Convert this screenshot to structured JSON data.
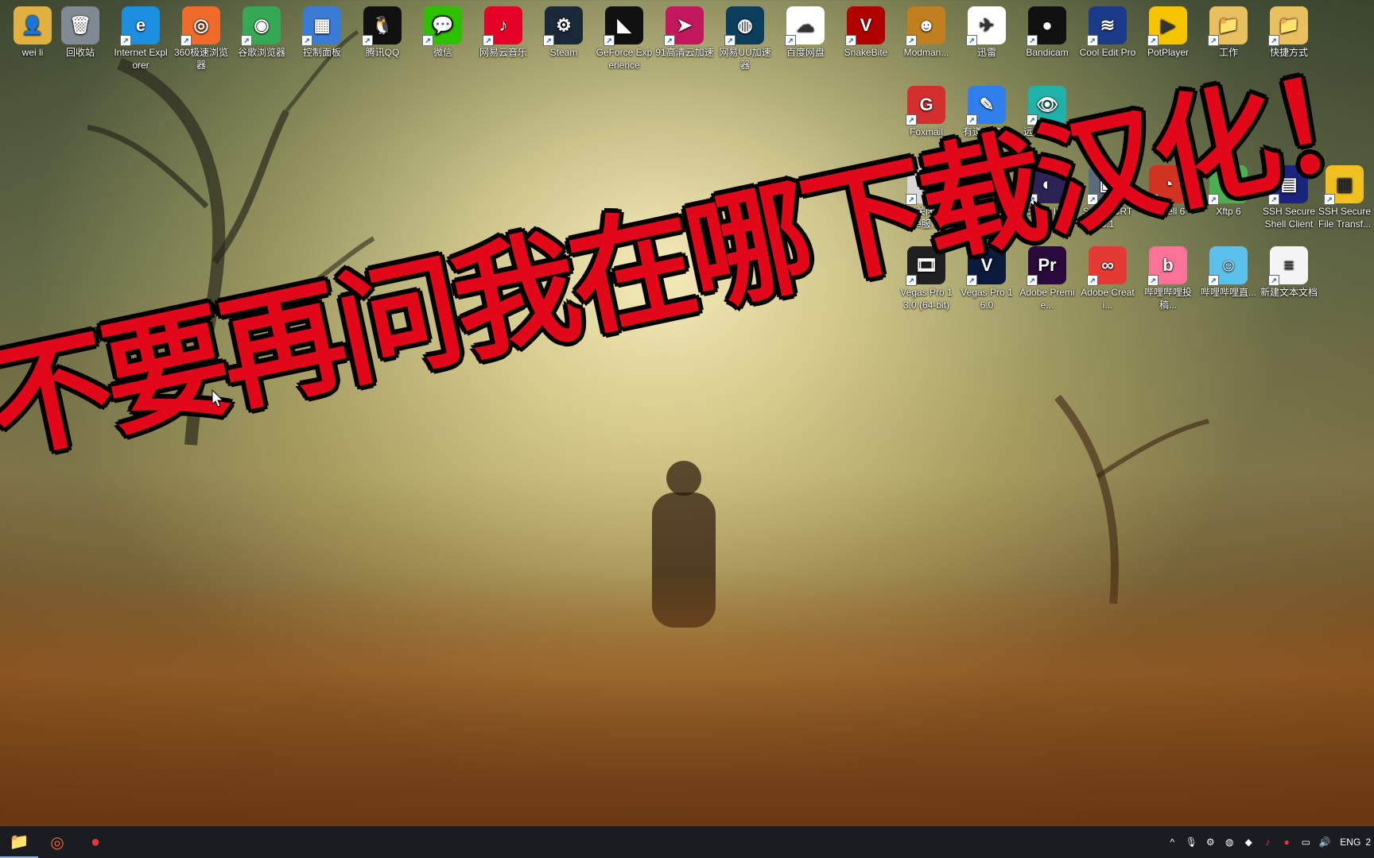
{
  "desktop": {
    "icons": [
      {
        "label": "wei li",
        "icon": "user-folder-icon",
        "color": "#e0b040",
        "glyph": "👤"
      },
      {
        "label": "回收站",
        "icon": "recycle-bin-icon",
        "color": "#7f8a93",
        "glyph": "🗑"
      },
      {
        "label": "Internet Explorer",
        "icon": "ie-icon",
        "color": "#1d8fe1",
        "glyph": "e"
      },
      {
        "label": "360极速浏览器",
        "icon": "360-browser-icon",
        "color": "#f06a2a",
        "glyph": "◎"
      },
      {
        "label": "谷歌浏览器",
        "icon": "chrome-icon",
        "color": "#34a853",
        "glyph": "◉"
      },
      {
        "label": "控制面板",
        "icon": "control-panel-icon",
        "color": "#3a7bd5",
        "glyph": "▦"
      },
      {
        "label": "腾讯QQ",
        "icon": "qq-icon",
        "color": "#111111",
        "glyph": "🐧"
      },
      {
        "label": "微信",
        "icon": "wechat-icon",
        "color": "#2dc100",
        "glyph": "💬"
      },
      {
        "label": "网易云音乐",
        "icon": "netease-music-icon",
        "color": "#e60026",
        "glyph": "♪"
      },
      {
        "label": "Steam",
        "icon": "steam-icon",
        "color": "#1b2838",
        "glyph": "⚙"
      },
      {
        "label": "GeForce Experience",
        "icon": "geforce-icon",
        "color": "#111111",
        "glyph": "◣"
      },
      {
        "label": "91高清云加速",
        "icon": "91-accelerator-icon",
        "color": "#c2185b",
        "glyph": "➤"
      },
      {
        "label": "网易UU加速器",
        "icon": "uu-accelerator-icon",
        "color": "#0b3d5c",
        "glyph": "◍"
      },
      {
        "label": "百度网盘",
        "icon": "baidu-netdisk-icon",
        "color": "#ffffff",
        "glyph": "☁"
      },
      {
        "label": "SnakeBite",
        "icon": "snakebite-icon",
        "color": "#b00000",
        "glyph": "V"
      },
      {
        "label": "Modman...",
        "icon": "modman-icon",
        "color": "#c08020",
        "glyph": "☻"
      },
      {
        "label": "迅雷",
        "icon": "thunder-icon",
        "color": "#ffffff",
        "glyph": "✈"
      },
      {
        "label": "Bandicam",
        "icon": "bandicam-icon",
        "color": "#111111",
        "glyph": "●"
      },
      {
        "label": "Cool Edit Pro",
        "icon": "cool-edit-icon",
        "color": "#1a3a8a",
        "glyph": "≋"
      },
      {
        "label": "PotPlayer",
        "icon": "potplayer-icon",
        "color": "#f5c400",
        "glyph": "▶"
      },
      {
        "label": "工作",
        "icon": "folder-icon",
        "color": "#e8c060",
        "glyph": "📁"
      },
      {
        "label": "快捷方式",
        "icon": "folder-icon",
        "color": "#e8c060",
        "glyph": "📁"
      },
      {
        "label": "Foxmail",
        "icon": "foxmail-icon",
        "color": "#d32f2f",
        "glyph": "G"
      },
      {
        "label": "有道云笔记",
        "icon": "youdao-note-icon",
        "color": "#2f80ed",
        "glyph": "✎"
      },
      {
        "label": "远程客户端",
        "icon": "remote-client-icon",
        "color": "#20b2aa",
        "glyph": "👁"
      },
      {
        "label": "开启关闭Oracle服...",
        "icon": "oracle-service-icon",
        "color": "#d8d8d8",
        "glyph": "⚙"
      },
      {
        "label": "PLSQL Developer",
        "icon": "plsql-icon",
        "color": "#9a2f6a",
        "glyph": "⛁"
      },
      {
        "label": "Eclipse IDE for Enter...",
        "icon": "eclipse-icon",
        "color": "#2c2255",
        "glyph": "◐"
      },
      {
        "label": "SecureCRT 8.1",
        "icon": "securecrt-icon",
        "color": "#5a6b7c",
        "glyph": "▣"
      },
      {
        "label": "Xshell 6",
        "icon": "xshell-icon",
        "color": "#d0331f",
        "glyph": "◔"
      },
      {
        "label": "Xftp 6",
        "icon": "xftp-icon",
        "color": "#4caf50",
        "glyph": "⇅"
      },
      {
        "label": "SSH Secure Shell Client",
        "icon": "ssh-client-icon",
        "color": "#1a237e",
        "glyph": "▤"
      },
      {
        "label": "SSH Secure File Transf...",
        "icon": "ssh-file-transfer-icon",
        "color": "#f0c020",
        "glyph": "▥"
      },
      {
        "label": "Vegas Pro 13.0 (64-bit)",
        "icon": "vegas-icon",
        "color": "#202020",
        "glyph": "🎞"
      },
      {
        "label": "Vegas Pro 16.0",
        "icon": "vegas-icon",
        "color": "#0a1a3a",
        "glyph": "V"
      },
      {
        "label": "Adobe Premie...",
        "icon": "premiere-icon",
        "color": "#2a0a3a",
        "glyph": "Pr"
      },
      {
        "label": "Adobe Creati...",
        "icon": "creative-cloud-icon",
        "color": "#e53935",
        "glyph": "∞"
      },
      {
        "label": "哔哩哔哩投稿...",
        "icon": "bilibili-upload-icon",
        "color": "#fb7299",
        "glyph": "b"
      },
      {
        "label": "哔哩哔哩直...",
        "icon": "bilibili-live-icon",
        "color": "#5bc0eb",
        "glyph": "☺"
      },
      {
        "label": "新建文本文档",
        "icon": "text-document-icon",
        "color": "#f4f4f4",
        "glyph": "≡"
      }
    ]
  },
  "overlay": {
    "banner_text": "不要再问我在哪下载汉化！"
  },
  "taskbar": {
    "apps": [
      {
        "name": "file-explorer",
        "icon": "folder-icon",
        "glyph": "📁",
        "color": "#f2c94c"
      },
      {
        "name": "360-browser",
        "icon": "360-browser-icon",
        "glyph": "◎",
        "color": "#f06a2a"
      },
      {
        "name": "bandicam",
        "icon": "bandicam-icon",
        "glyph": "●",
        "color": "#e53935"
      }
    ],
    "tray": {
      "chevron": "^",
      "input_language": "ENG",
      "clock_partial": "2"
    }
  }
}
